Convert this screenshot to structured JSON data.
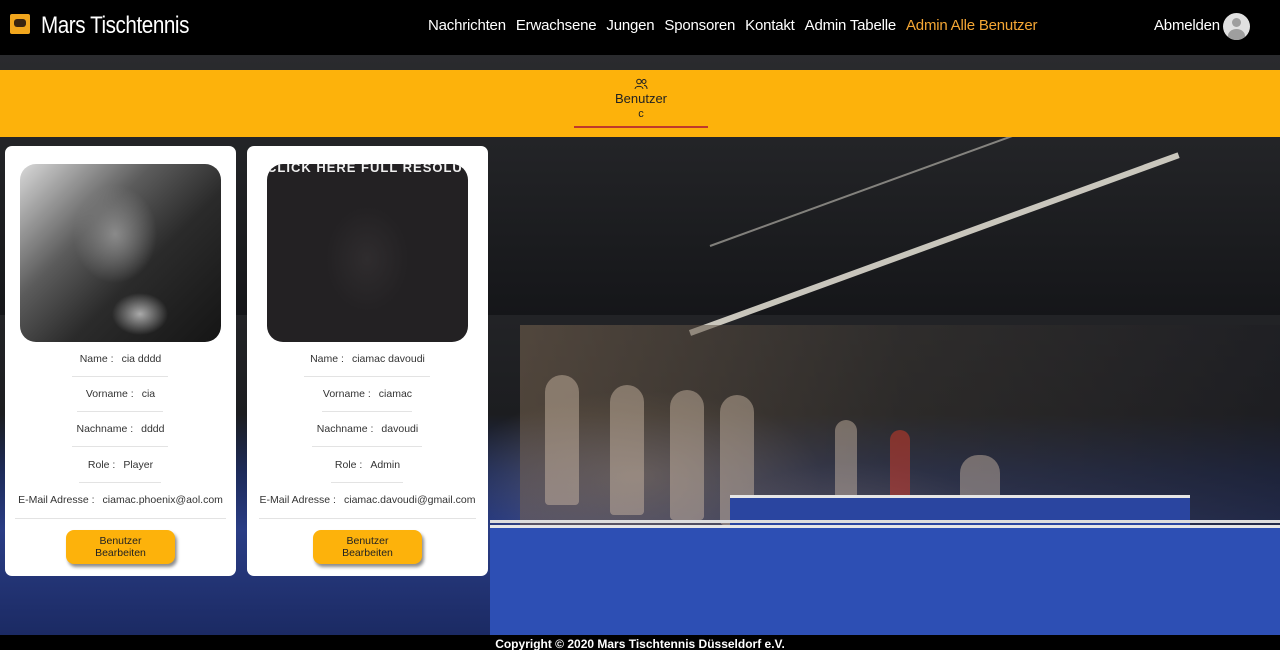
{
  "header": {
    "brand": "Mars Tischtennis",
    "nav": [
      {
        "label": "Nachrichten",
        "active": false
      },
      {
        "label": "Erwachsene",
        "active": false
      },
      {
        "label": "Jungen",
        "active": false
      },
      {
        "label": "Sponsoren",
        "active": false
      },
      {
        "label": "Kontakt",
        "active": false
      },
      {
        "label": "Admin Tabelle",
        "active": false
      },
      {
        "label": "Admin Alle Benutzer",
        "active": true
      }
    ],
    "logout": "Abmelden",
    "accent": "#f4a634"
  },
  "tabs": {
    "label": "Benutzer",
    "sub": "c",
    "icon": "users-icon"
  },
  "users": [
    {
      "fields": [
        {
          "key": "Name :",
          "value": "cia dddd"
        },
        {
          "key": "Vorname :",
          "value": "cia"
        },
        {
          "key": "Nachname :",
          "value": "dddd"
        },
        {
          "key": "Role :",
          "value": "Player"
        },
        {
          "key": "E-Mail Adresse :",
          "value": "ciamac.phoenix@aol.com"
        }
      ],
      "button": "Benutzer Bearbeiten"
    },
    {
      "banner": "CLICK HERE FULL RESOLUTION",
      "fields": [
        {
          "key": "Name :",
          "value": "ciamac davoudi"
        },
        {
          "key": "Vorname :",
          "value": "ciamac"
        },
        {
          "key": "Nachname :",
          "value": "davoudi"
        },
        {
          "key": "Role :",
          "value": "Admin"
        },
        {
          "key": "E-Mail Adresse :",
          "value": "ciamac.davoudi@gmail.com"
        }
      ],
      "button": "Benutzer Bearbeiten"
    }
  ],
  "footer": "Copyright © 2020  Mars Tischtennis Düsseldorf e.V.",
  "colors": {
    "band": "#fdb20b",
    "button": "#fdb20b"
  }
}
